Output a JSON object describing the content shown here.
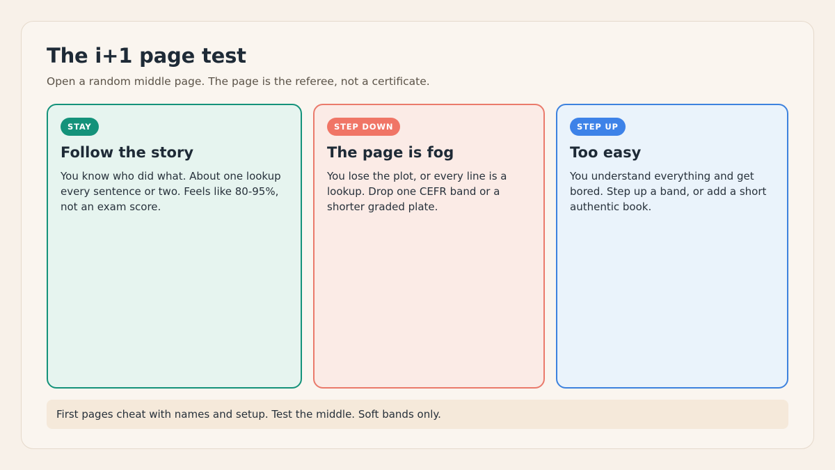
{
  "page": {
    "title": "The i+1 page test",
    "subtitle": "Open a random middle page. The page is the referee, not a certificate."
  },
  "cards": [
    {
      "badge": "STAY",
      "title": "Follow the story",
      "body": "You know who did what. About one lookup every sentence or two. Feels like 80-95%, not an exam score.",
      "color": "#14927a"
    },
    {
      "badge": "STEP DOWN",
      "title": "The page is fog",
      "body": "You lose the plot, or every line is a lookup. Drop one CEFR band or a shorter graded plate.",
      "color": "#ea7a6b"
    },
    {
      "badge": "STEP UP",
      "title": "Too easy",
      "body": "You understand everything and get bored. Step up a band, or add a short authentic book.",
      "color": "#3d82de"
    }
  ],
  "footer": {
    "note": "First pages cheat with names and setup. Test the middle. Soft bands only."
  }
}
